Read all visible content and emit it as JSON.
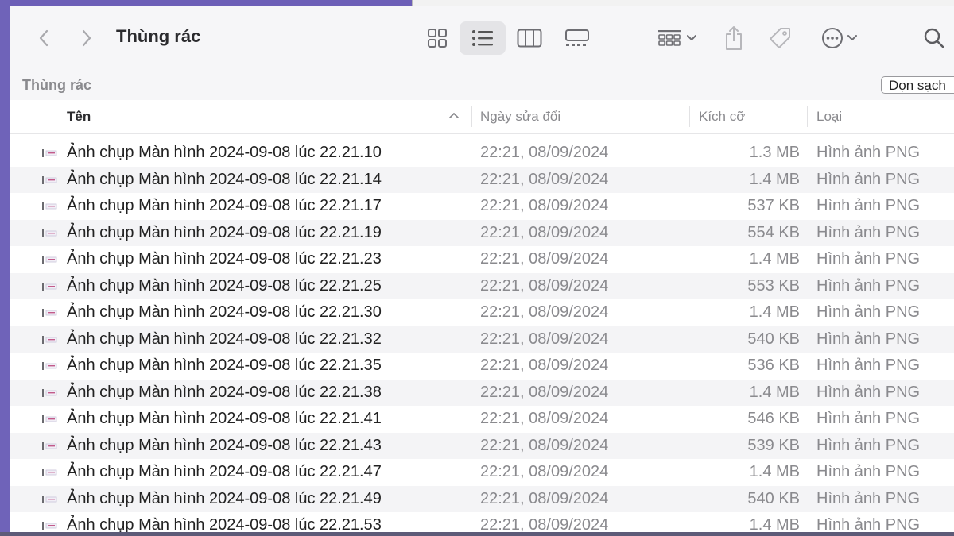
{
  "window": {
    "title": "Thùng rác",
    "location": "Thùng rác",
    "empty_button": "Dọn sạch"
  },
  "toolbar": {
    "icons": [
      "chevron-left-icon",
      "chevron-right-icon",
      "icon-view-grid-icon",
      "list-view-icon",
      "column-view-icon",
      "gallery-view-icon",
      "group-by-icon",
      "share-icon",
      "tag-icon",
      "more-actions-icon",
      "search-icon"
    ],
    "active_view": "list"
  },
  "columns": {
    "name": "Tên",
    "date": "Ngày sửa đổi",
    "size": "Kích cỡ",
    "kind": "Loại"
  },
  "sort": {
    "column": "name",
    "direction": "ascending"
  },
  "files": [
    {
      "name": "Ảnh chụp Màn hình 2024-09-08 lúc 22.21.10",
      "date": "22:21, 08/09/2024",
      "size": "1.3 MB",
      "kind": "Hình ảnh PNG"
    },
    {
      "name": "Ảnh chụp Màn hình 2024-09-08 lúc 22.21.14",
      "date": "22:21, 08/09/2024",
      "size": "1.4 MB",
      "kind": "Hình ảnh PNG"
    },
    {
      "name": "Ảnh chụp Màn hình 2024-09-08 lúc 22.21.17",
      "date": "22:21, 08/09/2024",
      "size": "537 KB",
      "kind": "Hình ảnh PNG"
    },
    {
      "name": "Ảnh chụp Màn hình 2024-09-08 lúc 22.21.19",
      "date": "22:21, 08/09/2024",
      "size": "554 KB",
      "kind": "Hình ảnh PNG"
    },
    {
      "name": "Ảnh chụp Màn hình 2024-09-08 lúc 22.21.23",
      "date": "22:21, 08/09/2024",
      "size": "1.4 MB",
      "kind": "Hình ảnh PNG"
    },
    {
      "name": "Ảnh chụp Màn hình 2024-09-08 lúc 22.21.25",
      "date": "22:21, 08/09/2024",
      "size": "553 KB",
      "kind": "Hình ảnh PNG"
    },
    {
      "name": "Ảnh chụp Màn hình 2024-09-08 lúc 22.21.30",
      "date": "22:21, 08/09/2024",
      "size": "1.4 MB",
      "kind": "Hình ảnh PNG"
    },
    {
      "name": "Ảnh chụp Màn hình 2024-09-08 lúc 22.21.32",
      "date": "22:21, 08/09/2024",
      "size": "540 KB",
      "kind": "Hình ảnh PNG"
    },
    {
      "name": "Ảnh chụp Màn hình 2024-09-08 lúc 22.21.35",
      "date": "22:21, 08/09/2024",
      "size": "536 KB",
      "kind": "Hình ảnh PNG"
    },
    {
      "name": "Ảnh chụp Màn hình 2024-09-08 lúc 22.21.38",
      "date": "22:21, 08/09/2024",
      "size": "1.4 MB",
      "kind": "Hình ảnh PNG"
    },
    {
      "name": "Ảnh chụp Màn hình 2024-09-08 lúc 22.21.41",
      "date": "22:21, 08/09/2024",
      "size": "546 KB",
      "kind": "Hình ảnh PNG"
    },
    {
      "name": "Ảnh chụp Màn hình 2024-09-08 lúc 22.21.43",
      "date": "22:21, 08/09/2024",
      "size": "539 KB",
      "kind": "Hình ảnh PNG"
    },
    {
      "name": "Ảnh chụp Màn hình 2024-09-08 lúc 22.21.47",
      "date": "22:21, 08/09/2024",
      "size": "1.4 MB",
      "kind": "Hình ảnh PNG"
    },
    {
      "name": "Ảnh chụp Màn hình 2024-09-08 lúc 22.21.49",
      "date": "22:21, 08/09/2024",
      "size": "540 KB",
      "kind": "Hình ảnh PNG"
    },
    {
      "name": "Ảnh chụp Màn hình 2024-09-08 lúc 22.21.53",
      "date": "22:21, 08/09/2024",
      "size": "1.4 MB",
      "kind": "Hình ảnh PNG"
    }
  ],
  "colors": {
    "toolbar_bg": "#f6f6f8",
    "stripe": "#f4f4f6",
    "secondary_text": "#8a8a8e",
    "desktop": "#6c5fb7"
  }
}
